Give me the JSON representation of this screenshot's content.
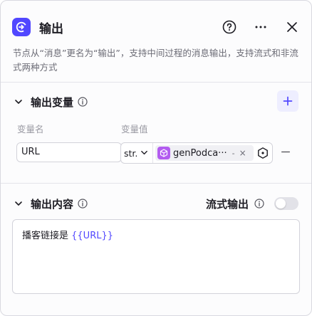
{
  "header": {
    "title": "输出",
    "icons": [
      "help-icon",
      "more-icon",
      "close-icon"
    ]
  },
  "description": "节点从“消息”更名为“输出”，支持中间过程的消息输出，支持流式和非流式两种方式",
  "output_variables": {
    "title": "输出变量",
    "add_label": "+",
    "col_name": "变量名",
    "col_value": "变量值",
    "rows": [
      {
        "name": "URL",
        "type": "str.",
        "ref_name": "genPodca···",
        "ref_dot": "-",
        "ref_clear": "×",
        "remove": "—"
      }
    ]
  },
  "output_content": {
    "title": "输出内容",
    "stream_label": "流式输出",
    "stream_enabled": false,
    "text_prefix": "播客链接是 ",
    "text_var": "{{URL}}"
  },
  "colors": {
    "accent": "#5147ff",
    "plugin": "#b35cf0"
  }
}
